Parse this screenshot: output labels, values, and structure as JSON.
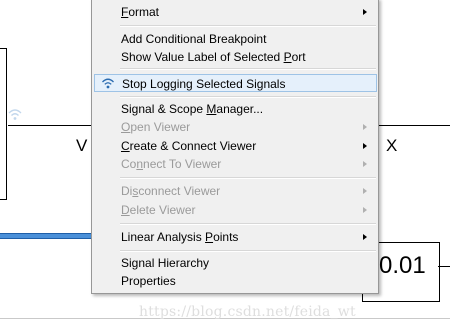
{
  "canvas": {
    "port_left_label": "V",
    "port_right_label": "X",
    "display_value": "0.01",
    "watermark": "https://blog.csdn.net/feida_wt"
  },
  "menu": {
    "items": [
      {
        "pre": "",
        "u": "F",
        "post": "ormat",
        "submenu": true,
        "disabled": false
      },
      {
        "pre": "Add Conditional Breakpoint",
        "u": "",
        "post": "",
        "submenu": false,
        "disabled": false
      },
      {
        "pre": "Show Value Label of Selected ",
        "u": "P",
        "post": "ort",
        "submenu": false,
        "disabled": false
      },
      {
        "pre": "Stop Logging Selected Signals",
        "u": "",
        "post": "",
        "submenu": false,
        "disabled": false,
        "highlighted": true,
        "icon": "wifi-icon"
      },
      {
        "pre": "Signal & Scope ",
        "u": "M",
        "post": "anager...",
        "submenu": false,
        "disabled": false
      },
      {
        "pre": "",
        "u": "O",
        "post": "pen Viewer",
        "submenu": true,
        "disabled": true
      },
      {
        "pre": "",
        "u": "C",
        "post": "reate & Connect Viewer",
        "submenu": true,
        "disabled": false
      },
      {
        "pre": "Co",
        "u": "n",
        "post": "nect To Viewer",
        "submenu": true,
        "disabled": true
      },
      {
        "pre": "Di",
        "u": "s",
        "post": "connect Viewer",
        "submenu": true,
        "disabled": true
      },
      {
        "pre": "",
        "u": "D",
        "post": "elete Viewer",
        "submenu": true,
        "disabled": true
      },
      {
        "pre": "Linear Analysis ",
        "u": "P",
        "post": "oints",
        "submenu": true,
        "disabled": false
      },
      {
        "pre": "Signal Hierarchy",
        "u": "",
        "post": "",
        "submenu": false,
        "disabled": false
      },
      {
        "pre": "Properties",
        "u": "",
        "post": "",
        "submenu": false,
        "disabled": false
      }
    ]
  }
}
